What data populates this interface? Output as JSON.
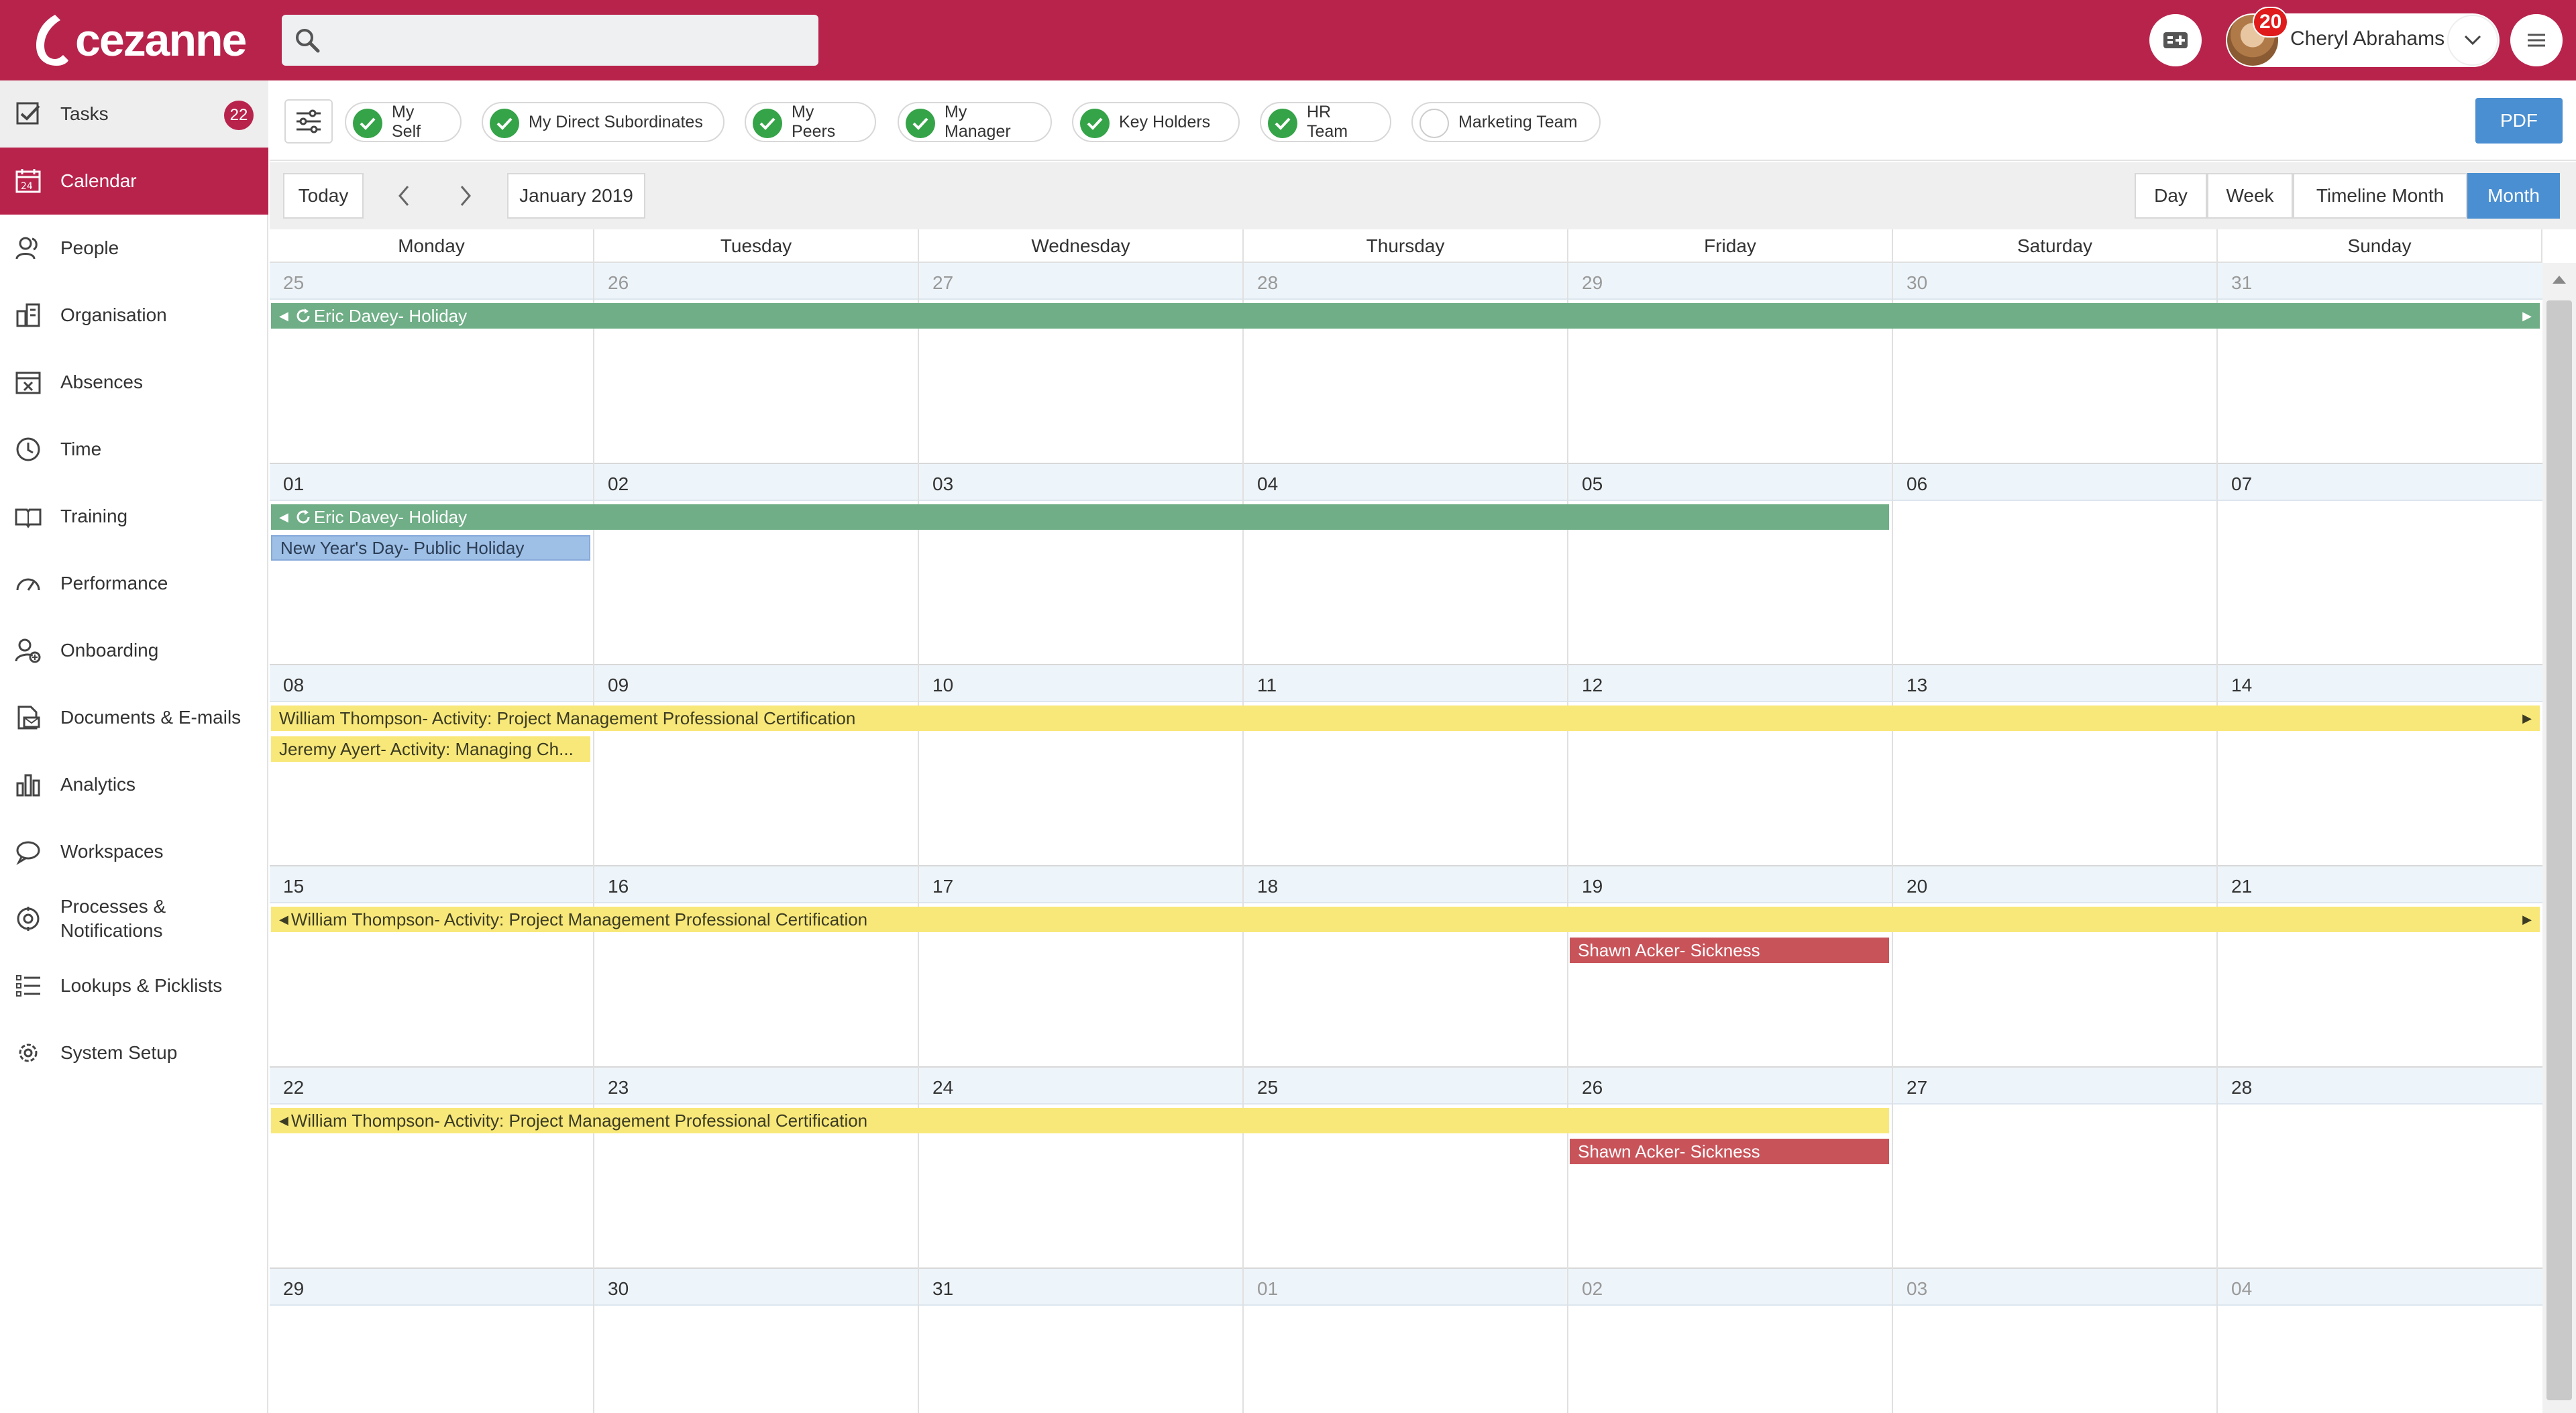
{
  "brand": {
    "name": "cezanne",
    "color": "#b8234c"
  },
  "search": {
    "placeholder": ""
  },
  "user": {
    "name": "Cheryl Abrahams",
    "notifications": "20"
  },
  "sidebar": {
    "items": [
      {
        "label": "Tasks",
        "icon": "task-check-icon",
        "badge": "22"
      },
      {
        "label": "Calendar",
        "icon": "calendar-icon"
      },
      {
        "label": "People",
        "icon": "people-icon"
      },
      {
        "label": "Organisation",
        "icon": "organisation-icon"
      },
      {
        "label": "Absences",
        "icon": "absences-icon"
      },
      {
        "label": "Time",
        "icon": "clock-icon"
      },
      {
        "label": "Training",
        "icon": "book-icon"
      },
      {
        "label": "Performance",
        "icon": "gauge-icon"
      },
      {
        "label": "Onboarding",
        "icon": "onboarding-icon"
      },
      {
        "label": "Documents & E-mails",
        "icon": "documents-icon"
      },
      {
        "label": "Analytics",
        "icon": "bar-chart-icon"
      },
      {
        "label": "Workspaces",
        "icon": "chat-icon"
      },
      {
        "label": "Processes &",
        "label2": "Notifications",
        "icon": "processes-icon"
      },
      {
        "label": "Lookups & Picklists",
        "icon": "list-icon"
      },
      {
        "label": "System Setup",
        "icon": "gear-icon"
      }
    ]
  },
  "filters": {
    "chips": [
      {
        "label": "My Self",
        "checked": true
      },
      {
        "label": "My Direct Subordinates",
        "checked": true
      },
      {
        "label": "My Peers",
        "checked": true
      },
      {
        "label": "My Manager",
        "checked": true
      },
      {
        "label": "Key Holders",
        "checked": true
      },
      {
        "label": "HR Team",
        "checked": true
      },
      {
        "label": "Marketing Team",
        "checked": false
      }
    ],
    "pdf_label": "PDF"
  },
  "toolbar": {
    "today_label": "Today",
    "month_label": "January 2019",
    "views": [
      "Day",
      "Week",
      "Timeline Month",
      "Month"
    ],
    "active_view": "Month"
  },
  "calendar": {
    "weekdays": [
      "Monday",
      "Tuesday",
      "Wednesday",
      "Thursday",
      "Friday",
      "Saturday",
      "Sunday"
    ],
    "weeks": [
      {
        "days": [
          "25",
          "26",
          "27",
          "28",
          "29",
          "30",
          "31"
        ],
        "dim": [
          true,
          true,
          true,
          true,
          true,
          true,
          true
        ],
        "events": [
          {
            "label": "Eric Davey- Holiday",
            "color": "green",
            "start": 0,
            "span": 7,
            "row": 0,
            "left_arrow": true,
            "right_arrow": true,
            "recurring": true
          }
        ]
      },
      {
        "days": [
          "01",
          "02",
          "03",
          "04",
          "05",
          "06",
          "07"
        ],
        "dim": [
          false,
          false,
          false,
          false,
          false,
          false,
          false
        ],
        "events": [
          {
            "label": "Eric Davey- Holiday",
            "color": "green",
            "start": 0,
            "span": 5,
            "row": 0,
            "left_arrow": true,
            "right_arrow": false,
            "recurring": true
          },
          {
            "label": "New Year's Day- Public Holiday",
            "color": "blue",
            "start": 0,
            "span": 1,
            "row": 1,
            "left_arrow": false,
            "right_arrow": false
          }
        ]
      },
      {
        "days": [
          "08",
          "09",
          "10",
          "11",
          "12",
          "13",
          "14"
        ],
        "dim": [
          false,
          false,
          false,
          false,
          false,
          false,
          false
        ],
        "events": [
          {
            "label": "William Thompson- Activity: Project Management Professional Certification",
            "color": "yellow",
            "start": 0,
            "span": 7,
            "row": 0,
            "left_arrow": false,
            "right_arrow": true
          },
          {
            "label": "Jeremy Ayert- Activity: Managing Ch...",
            "color": "yellow",
            "start": 0,
            "span": 1,
            "row": 1,
            "left_arrow": false,
            "right_arrow": false
          }
        ]
      },
      {
        "days": [
          "15",
          "16",
          "17",
          "18",
          "19",
          "20",
          "21"
        ],
        "dim": [
          false,
          false,
          false,
          false,
          false,
          false,
          false
        ],
        "events": [
          {
            "label": "William Thompson- Activity: Project Management Professional Certification",
            "color": "yellow",
            "start": 0,
            "span": 7,
            "row": 0,
            "left_arrow": true,
            "right_arrow": true
          },
          {
            "label": "Shawn Acker- Sickness",
            "color": "red",
            "start": 4,
            "span": 1,
            "row": 1,
            "left_arrow": false,
            "right_arrow": false
          }
        ]
      },
      {
        "days": [
          "22",
          "23",
          "24",
          "25",
          "26",
          "27",
          "28"
        ],
        "dim": [
          false,
          false,
          false,
          false,
          false,
          false,
          false
        ],
        "events": [
          {
            "label": "William Thompson- Activity: Project Management Professional Certification",
            "color": "yellow",
            "start": 0,
            "span": 5,
            "row": 0,
            "left_arrow": true,
            "right_arrow": false
          },
          {
            "label": "Shawn Acker- Sickness",
            "color": "red",
            "start": 4,
            "span": 1,
            "row": 1,
            "left_arrow": false,
            "right_arrow": false
          }
        ]
      },
      {
        "days": [
          "29",
          "30",
          "31",
          "01",
          "02",
          "03",
          "04"
        ],
        "dim": [
          false,
          false,
          false,
          true,
          true,
          true,
          true
        ],
        "events": []
      }
    ]
  }
}
